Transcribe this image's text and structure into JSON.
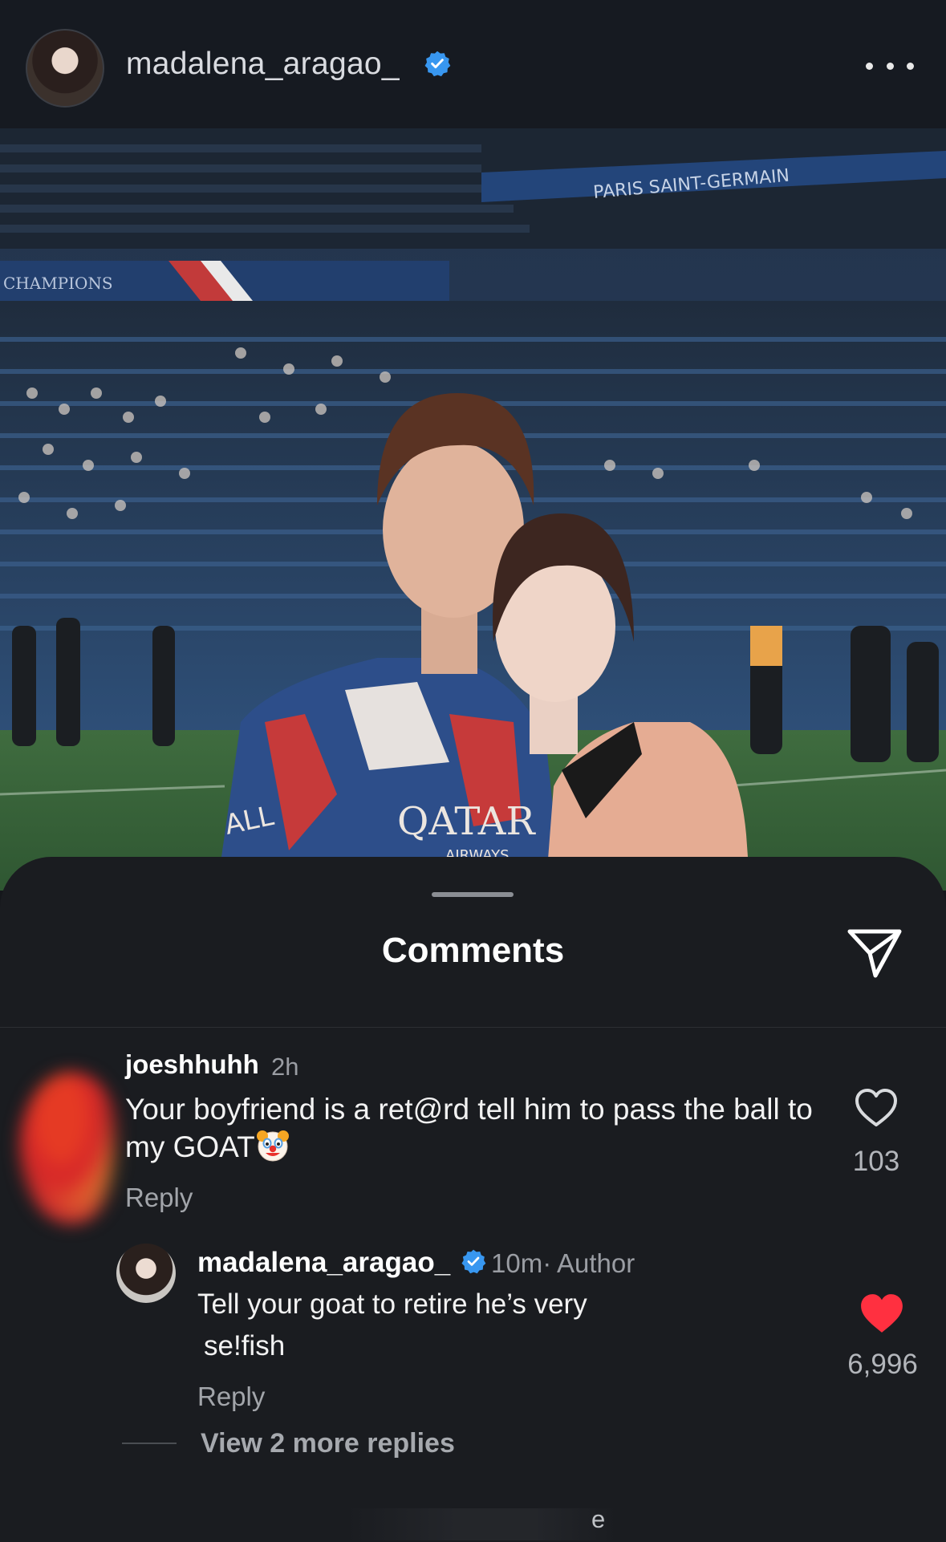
{
  "header": {
    "username": "madalena_aragao_",
    "verified": true,
    "more_icon": "ellipsis-icon"
  },
  "photo": {
    "stadium_banner": "PARIS SAINT-GERMAIN",
    "jersey_sponsor": "QATAR",
    "jersey_sponsor_sub": "AIRWAYS",
    "jersey_sleeve": "ALL",
    "stand_banner": "CHAMPIONS"
  },
  "comments_sheet": {
    "title": "Comments",
    "share_icon": "send-icon",
    "comments": [
      {
        "username": "joeshhuhh",
        "time": "2h",
        "text": "Your boyfriend is a ret@rd tell him to pass the ball to my GOAT",
        "emoji": "clown-face-icon",
        "reply_label": "Reply",
        "like_icon": "heart-outline-icon",
        "likes": "103",
        "replies": [
          {
            "username": "madalena_aragao_",
            "verified": true,
            "time": "10m·",
            "author_label": "Author",
            "text_line1": "Tell your goat to retire he’s very",
            "text_line2": "se!fish",
            "reply_label": "Reply",
            "like_icon": "heart-filled-icon",
            "likes": "6,996"
          }
        ],
        "view_more": "View 2 more replies"
      }
    ],
    "partial_bottom_text": "e"
  },
  "colors": {
    "background": "#15171b",
    "sheet": "#1a1c20",
    "verified_blue": "#3897f0",
    "like_red": "#ff3040"
  }
}
